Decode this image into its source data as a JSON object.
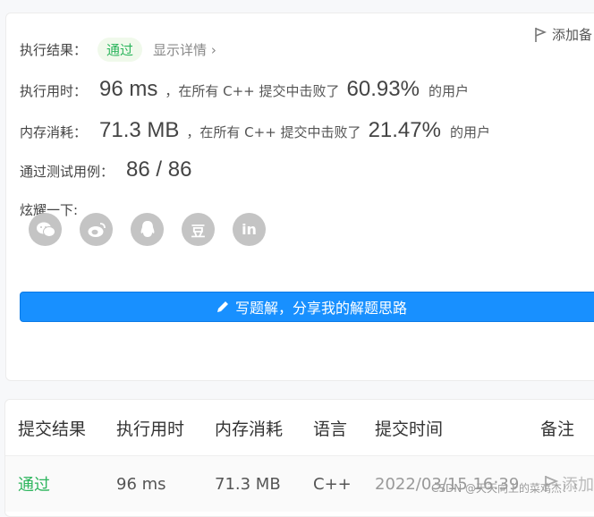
{
  "result": {
    "label": "执行结果：",
    "status": "通过",
    "detail": "显示详情",
    "add_note": "添加备"
  },
  "runtime": {
    "label": "执行用时：",
    "value": "96 ms",
    "mid": "，在所有 C++ 提交中击败了",
    "percent": "60.93%",
    "suffix": "的用户"
  },
  "memory": {
    "label": "内存消耗：",
    "value": "71.3 MB",
    "mid": "，在所有 C++ 提交中击败了",
    "percent": "21.47%",
    "suffix": "的用户"
  },
  "tests": {
    "label": "通过测试用例：",
    "value": "86 / 86"
  },
  "share": {
    "label": "炫耀一下:",
    "icons": [
      "wechat-icon",
      "weibo-icon",
      "qq-icon",
      "douban-icon",
      "linkedin-icon"
    ],
    "douban_glyph": "豆",
    "linkedin_glyph": "in"
  },
  "write_button": "写题解，分享我的解题思路",
  "table": {
    "headers": [
      "提交结果",
      "执行用时",
      "内存消耗",
      "语言",
      "提交时间",
      "备注"
    ],
    "row": {
      "status": "通过",
      "runtime": "96 ms",
      "memory": "71.3 MB",
      "language": "C++",
      "time": "2022/03/15 16:39",
      "note": "添加"
    }
  },
  "watermark": "CSDN @天天向上的菜鸡杰！！",
  "colors": {
    "accent": "#1890ff",
    "success": "#2db55d"
  }
}
